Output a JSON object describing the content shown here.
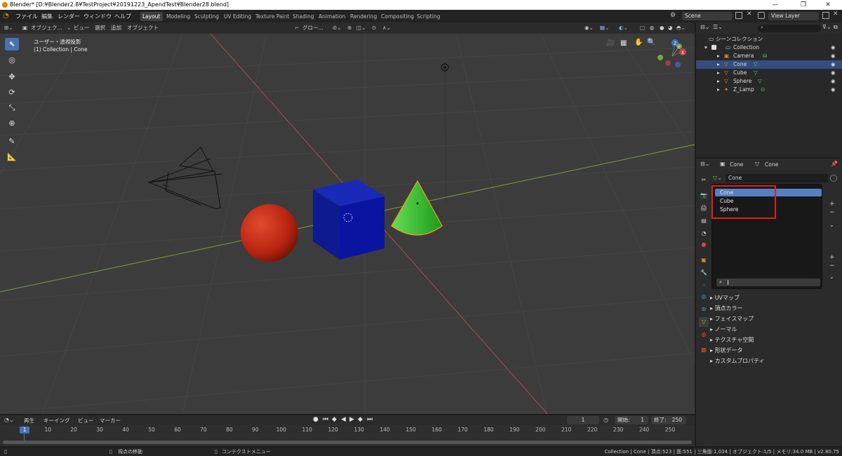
{
  "window": {
    "title": "Blender* [D:¥Blender2.8¥TestProject¥20191223_ApendTest¥Blender28.blend]",
    "minimize": "—",
    "maximize": "❐",
    "close": "✕"
  },
  "menu": {
    "items": [
      "ファイル",
      "編集",
      "レンダー",
      "ウィンドウ",
      "ヘルプ"
    ],
    "workspaces": [
      "Layout",
      "Modeling",
      "Sculpting",
      "UV Editing",
      "Texture Paint",
      "Shading",
      "Animation",
      "Rendering",
      "Compositing",
      "Scripting"
    ],
    "active_workspace": "Layout",
    "scene_label": "Scene",
    "view_layer_label": "View Layer"
  },
  "viewport_header": {
    "mode": "オブジェク...",
    "menus": [
      "ビュー",
      "選択",
      "追加",
      "オブジェクト"
    ],
    "transform_orientation": "グロー..."
  },
  "viewport": {
    "view_name": "ユーザー・透視投影",
    "collection_info": "(1) Collection | Cone",
    "gizmo_axes": {
      "x": "X",
      "y": "Y",
      "z": "Z"
    },
    "colors": {
      "bg": "#3c3c3c",
      "grid": "#444444",
      "x_axis": "#a84d55",
      "y_axis": "#7d9c3a",
      "cone": "#33bb33",
      "cube": "#0a14a0",
      "sphere": "#b82410"
    }
  },
  "outliner": {
    "root": "シーンコレクション",
    "collection": "Collection",
    "items": [
      {
        "name": "Camera",
        "icon": "camera-icon",
        "selected": false
      },
      {
        "name": "Cone",
        "icon": "mesh-icon",
        "selected": true
      },
      {
        "name": "Cube",
        "icon": "mesh-icon",
        "selected": false
      },
      {
        "name": "Sphere",
        "icon": "mesh-icon",
        "selected": false
      },
      {
        "name": "Z_Lamp",
        "icon": "light-icon",
        "selected": false
      }
    ]
  },
  "properties": {
    "object_name": "Cone",
    "data_name": "Cone",
    "mesh_field": "Cone",
    "panels": [
      "UVマップ",
      "頂点カラー",
      "フェイスマップ",
      "ノーマル",
      "テクスチャ空間",
      "形状データ",
      "カスタムプロパティ"
    ]
  },
  "dropdown": {
    "items": [
      "Cone",
      "Cube",
      "Sphere"
    ],
    "highlighted": "Cone",
    "search_placeholder": "",
    "highlight_box_color": "#e02020"
  },
  "timeline": {
    "menus": [
      "再生",
      "キーイング",
      "ビュー",
      "マーカー"
    ],
    "current_frame": "1",
    "start_label": "開始:",
    "start_value": "1",
    "end_label": "終了:",
    "end_value": "250",
    "ticks": [
      "1",
      "10",
      "20",
      "30",
      "40",
      "50",
      "60",
      "70",
      "80",
      "90",
      "100",
      "110",
      "120",
      "130",
      "140",
      "150",
      "160",
      "170",
      "180",
      "190",
      "200",
      "210",
      "220",
      "230",
      "240",
      "250"
    ]
  },
  "status": {
    "left_action": "視点の移動",
    "middle_action": "コンテクストメニュー",
    "stats": "Collection | Cone | 頂点:523 | 面:551 | 三角面:1,034 | オブジェクト:1/5 | メモリ:34.0 MB | v2.80.75"
  }
}
